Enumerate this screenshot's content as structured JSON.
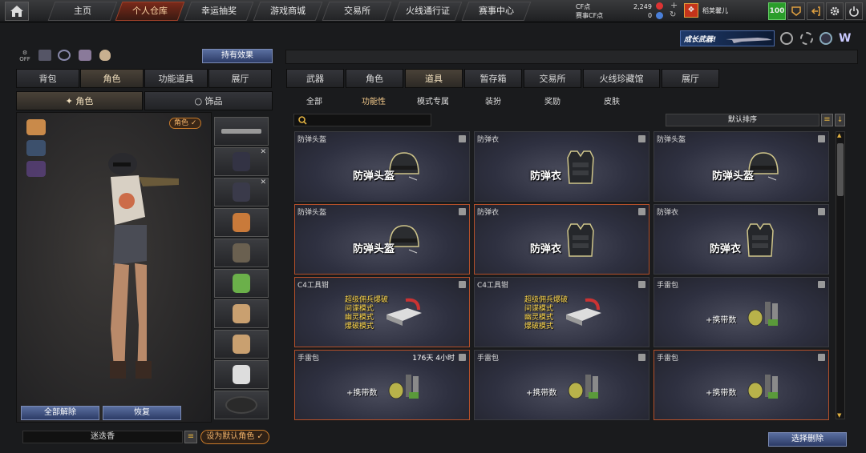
{
  "topbar": {
    "tabs": [
      "主页",
      "个人仓库",
      "幸运抽奖",
      "游戏商城",
      "交易所",
      "火线通行证",
      "赛事中心"
    ],
    "active_tab": 1,
    "cf_label": "CF点",
    "cf_value": "2,249",
    "match_cf_label": "赛事CF点",
    "match_cf_value": "0",
    "player_name": "稻荚馨儿",
    "level_badge": "100"
  },
  "banner": {
    "text": "成长武器!"
  },
  "left": {
    "effect_button": "持有效果",
    "tabs": [
      "背包",
      "角色",
      "功能道具",
      "展厅"
    ],
    "active_tab": 1,
    "subtabs": [
      "角色",
      "饰品"
    ],
    "role_tag": "角色 ✓",
    "unequip_all": "全部解除",
    "restore": "恢复",
    "preset_name": "迷迭香",
    "set_default": "设为默认角色 ✓"
  },
  "right": {
    "tabs": [
      "武器",
      "角色",
      "道具",
      "暂存箱",
      "交易所",
      "火线珍藏馆",
      "展厅"
    ],
    "active_tab": 2,
    "filters": [
      "全部",
      "功能性",
      "模式专属",
      "装扮",
      "奖励",
      "皮肤"
    ],
    "active_filter": 1,
    "search_placeholder": "",
    "sort_label": "默认排序",
    "batch_delete": "选择删除",
    "items": [
      {
        "name": "防弹头盔",
        "label": "防弹头盔",
        "kind": "helmet",
        "selected": false,
        "timer": ""
      },
      {
        "name": "防弹衣",
        "label": "防弹衣",
        "kind": "vest",
        "selected": false,
        "timer": ""
      },
      {
        "name": "防弹头盔",
        "label": "防弹头盔",
        "kind": "helmet",
        "selected": false,
        "timer": ""
      },
      {
        "name": "防弹头盔",
        "label": "防弹头盔",
        "kind": "helmet",
        "selected": true,
        "timer": ""
      },
      {
        "name": "防弹衣",
        "label": "防弹衣",
        "kind": "vest",
        "selected": true,
        "timer": ""
      },
      {
        "name": "防弹衣",
        "label": "防弹衣",
        "kind": "vest",
        "selected": false,
        "timer": ""
      },
      {
        "name": "C4工具钳",
        "label": "",
        "kind": "c4",
        "selected": true,
        "timer": "",
        "modes": [
          "超级佣兵爆破",
          "间谍模式",
          "幽灵模式",
          "爆破模式"
        ]
      },
      {
        "name": "C4工具钳",
        "label": "",
        "kind": "c4",
        "selected": false,
        "timer": "",
        "modes": [
          "超级佣兵爆破",
          "间谍模式",
          "幽灵模式",
          "爆破模式"
        ]
      },
      {
        "name": "手雷包",
        "label": "+携带数",
        "kind": "grenade",
        "selected": false,
        "timer": ""
      },
      {
        "name": "手雷包",
        "label": "+携带数",
        "kind": "grenade",
        "selected": true,
        "timer": "176天 4小时"
      },
      {
        "name": "手雷包",
        "label": "+携带数",
        "kind": "grenade",
        "selected": false,
        "timer": ""
      },
      {
        "name": "手雷包",
        "label": "+携带数",
        "kind": "grenade",
        "selected": true,
        "timer": ""
      }
    ]
  }
}
